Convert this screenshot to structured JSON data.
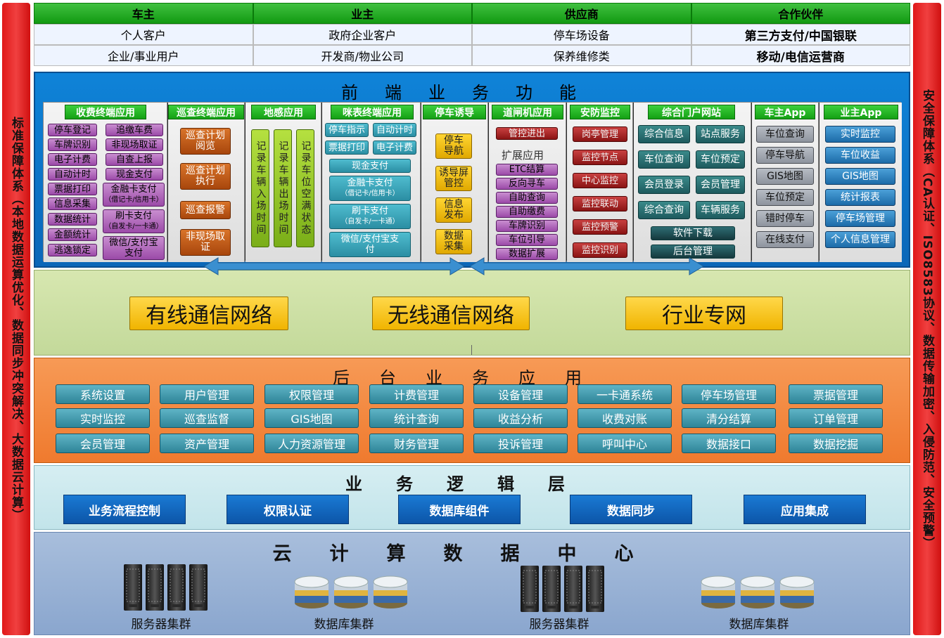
{
  "left_side": "标准保障体系（本地数据运算优化、数据同步冲突解决、大数据云计算）",
  "right_side": "安全保障体系（CA认证、ISO8583协议、数据传输加密、入侵防范、安全预警）",
  "top_table": {
    "headers": [
      "车主",
      "业主",
      "供应商",
      "合作伙伴"
    ],
    "row1": [
      "个人客户",
      "政府企业客户",
      "停车场设备",
      "第三方支付/中国银联"
    ],
    "row2": [
      "企业/事业用户",
      "开发商/物业公司",
      "保养维修类",
      "移动/电信运营商"
    ]
  },
  "front": {
    "title": "前端业务功能",
    "charge": {
      "title": "收费终端应用",
      "left": [
        "停车登记",
        "车牌识别",
        "电子计费",
        "自动计时",
        "票据打印",
        "信息采集",
        "数据统计",
        "金额统计",
        "逃逸锁定"
      ],
      "right": [
        "追缴车费",
        "非现场取证",
        "自查上报",
        "现金支付"
      ],
      "card1": "金融卡支付",
      "card1_sub": "（借记卡/信用卡）",
      "card2": "刷卡支付",
      "card2_sub": "（自发卡/一卡通）",
      "wx": "微信/支付宝支付"
    },
    "patrol": {
      "title": "巡查终端应用",
      "items": [
        "巡查计划阅览",
        "巡查计划执行",
        "巡查报警",
        "非现场取证"
      ]
    },
    "ground": {
      "title": "地感应用",
      "items": [
        "记录车辆入场时间",
        "记录车辆出场时间",
        "记录车位空满状态"
      ]
    },
    "meter": {
      "title": "咪表终端应用",
      "a": "停车指示",
      "b": "自动计时",
      "c": "票据打印",
      "d": "电子计费",
      "cash": "现金支付",
      "card1": "金融卡支付",
      "card1_sub": "（借记卡/信用卡）",
      "card2": "刷卡支付",
      "card2_sub": "（自发卡/一卡通）",
      "wx": "微信/支付宝支付"
    },
    "screen": {
      "title": "停车诱导",
      "items": [
        "停车导航",
        "诱导屏管控",
        "信息发布",
        "数据采集"
      ]
    },
    "gate": {
      "title": "道闸机应用",
      "top": "管控进出",
      "ext": "扩展应用",
      "items": [
        "ETC结算",
        "反向寻车",
        "自助查询",
        "自助缴费",
        "车牌识别",
        "车位引导",
        "数据扩展"
      ]
    },
    "security": {
      "title": "安防监控",
      "items": [
        "岗亭管理",
        "监控节点",
        "中心监控",
        "监控联动",
        "监控预警",
        "监控识别"
      ]
    },
    "portal": {
      "title": "综合门户网站",
      "items": [
        "综合信息",
        "站点服务",
        "车位查询",
        "车位预定",
        "会员登录",
        "会员管理",
        "综合查询",
        "车辆服务"
      ],
      "dl": "软件下载",
      "admin": "后台管理"
    },
    "owner_app": {
      "title": "车主App",
      "items": [
        "车位查询",
        "停车导航",
        "GIS地图",
        "车位预定",
        "错时停车",
        "在线支付"
      ]
    },
    "biz_app": {
      "title": "业主App",
      "items": [
        "实时监控",
        "车位收益",
        "GIS地图",
        "统计报表",
        "停车场管理",
        "个人信息管理"
      ]
    }
  },
  "network": {
    "items": [
      "有线通信网络",
      "无线通信网络",
      "行业专网"
    ]
  },
  "backend": {
    "title": "后台业务应用",
    "rows": [
      [
        "系统设置",
        "用户管理",
        "权限管理",
        "计费管理",
        "设备管理",
        "一卡通系统",
        "停车场管理",
        "票据管理"
      ],
      [
        "实时监控",
        "巡查监督",
        "GIS地图",
        "统计查询",
        "收益分析",
        "收费对账",
        "清分结算",
        "订单管理"
      ],
      [
        "会员管理",
        "资产管理",
        "人力资源管理",
        "财务管理",
        "投诉管理",
        "呼叫中心",
        "数据接口",
        "数据挖掘"
      ]
    ]
  },
  "logic": {
    "title": "业务逻辑层",
    "items": [
      "业务流程控制",
      "权限认证",
      "数据库组件",
      "数据同步",
      "应用集成"
    ]
  },
  "cloud": {
    "title": "云计算数据中心",
    "captions": [
      "服务器集群",
      "数据库集群",
      "服务器集群",
      "数据库集群"
    ]
  },
  "colors": {
    "side": "#e82020",
    "header_green": "#1aa61a",
    "front_blue": "#0b73c8",
    "network": "#cfe1a8",
    "backend": "#f28a40",
    "logic": "#cbe8ee",
    "cloud": "#9cb4d8"
  }
}
